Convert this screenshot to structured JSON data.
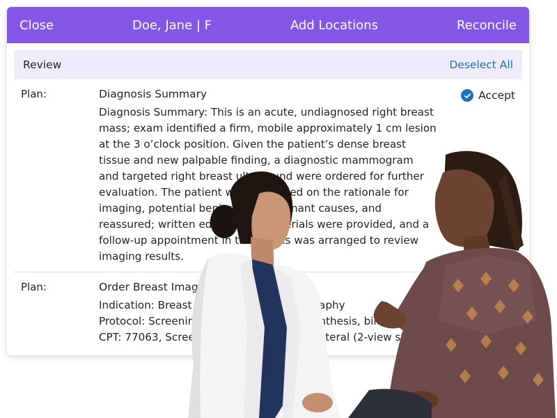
{
  "toolbar": {
    "close_label": "Close",
    "patient_label": "Doe, Jane | F",
    "add_locations_label": "Add Locations",
    "reconcile_label": "Reconcile"
  },
  "review": {
    "title": "Review",
    "deselect_label": "Deselect All"
  },
  "plans": [
    {
      "label": "Plan:",
      "title": "Diagnosis Summary",
      "lines": [
        "Diagnosis Summary: This is an acute, undiagnosed right breast",
        "mass; exam identified a firm, mobile approximately 1 cm lesion",
        "at the 3 o’clock position. Given the patient’s dense breast",
        "tissue and new palpable finding, a diagnostic mammogram",
        "and targeted right breast ultrasound were ordered for further",
        "evaluation. The patient was counseled on the rationale for",
        "imaging, potential benign and malignant causes, and",
        "reassured; written educational materials were provided, and a",
        "follow-up appointment in two weeks was arranged to review",
        "imaging results."
      ],
      "accept_label": "Accept"
    },
    {
      "label": "Plan:",
      "title": "Order Breast Imaging",
      "lines": [
        "Indication: Breast Screening — Mammography",
        "Protocol: Screening Digital Breast Tomosynthesis, bilateral",
        "CPT: 77063, Screening Tomosynthesis, Bilateral (2-view study)"
      ]
    }
  ],
  "colors": {
    "header_bg": "#8257e6",
    "review_bg": "#efebfa",
    "link": "#1f6dbd",
    "check": "#1f6dbd"
  },
  "photo": {
    "description_icon": "two-women-conversation-photo"
  }
}
